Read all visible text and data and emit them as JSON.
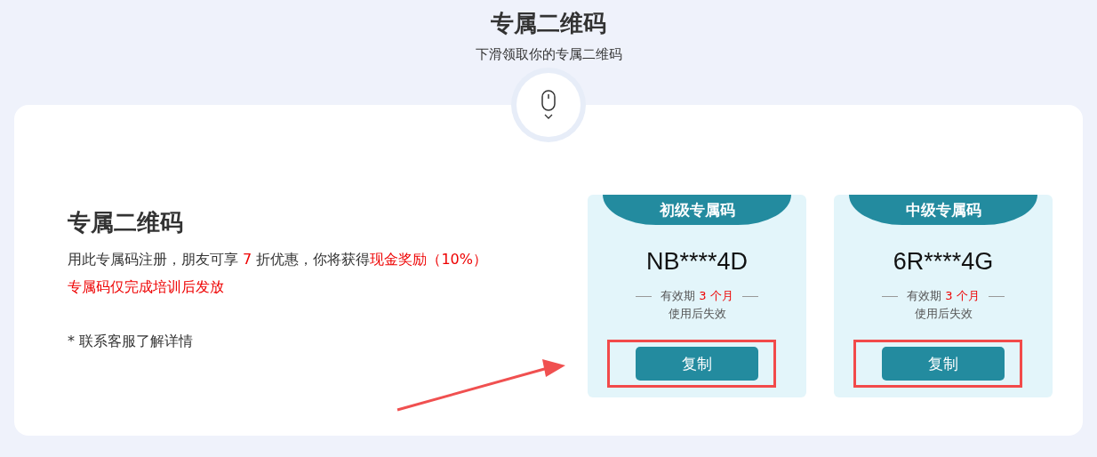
{
  "header": {
    "title": "专属二维码",
    "subtitle": "下滑领取你的专属二维码"
  },
  "intro": {
    "title": "专属二维码",
    "description": [
      {
        "text": "用此专属码注册，朋友可享 ",
        "highlight": false
      },
      {
        "text": "7",
        "highlight": true
      },
      {
        "text": " 折优惠，你将获得",
        "highlight": false
      },
      {
        "text": "现金奖励（10%）",
        "highlight": true
      }
    ],
    "notice": "专属码仅完成培训后发放",
    "footnote": "* 联系客服了解详情"
  },
  "cards": [
    {
      "title": "初级专属码",
      "code": "NB****4D",
      "validity_label": "有效期",
      "validity_value": "3 个月",
      "note": "使用后失效",
      "button": "复制",
      "highlighted": true
    },
    {
      "title": "中级专属码",
      "code": "6R****4G",
      "validity_label": "有效期",
      "validity_value": "3 个月",
      "note": "使用后失效",
      "button": "复制",
      "highlighted": true
    }
  ],
  "annotation": {
    "arrow": true
  }
}
